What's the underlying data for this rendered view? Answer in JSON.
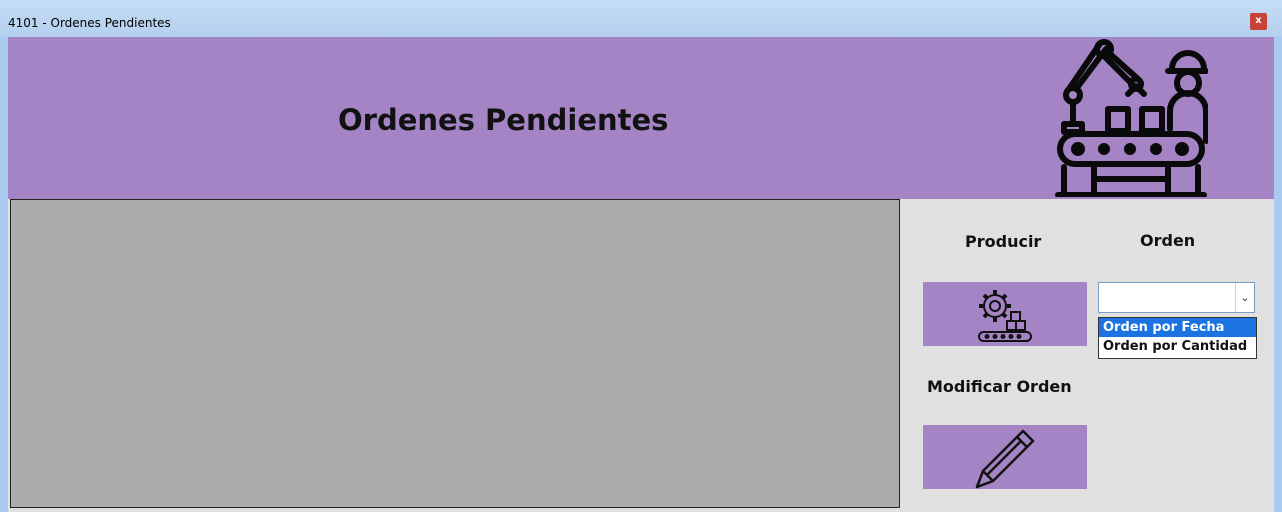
{
  "window": {
    "title": "4101 - Ordenes Pendientes",
    "close_label": "x"
  },
  "header": {
    "title": "Ordenes Pendientes",
    "icon": "factory-worker-icon",
    "background": "#a584c6"
  },
  "actions": {
    "producir_label": "Producir",
    "producir_icon": "gear-conveyor-icon",
    "modificar_label": "Modificar Orden",
    "modificar_icon": "pencil-icon"
  },
  "orden": {
    "label": "Orden",
    "selected_value": "",
    "options": [
      "Orden por Fecha",
      "Orden por Cantidad"
    ],
    "highlighted_option": "Orden por Fecha"
  }
}
